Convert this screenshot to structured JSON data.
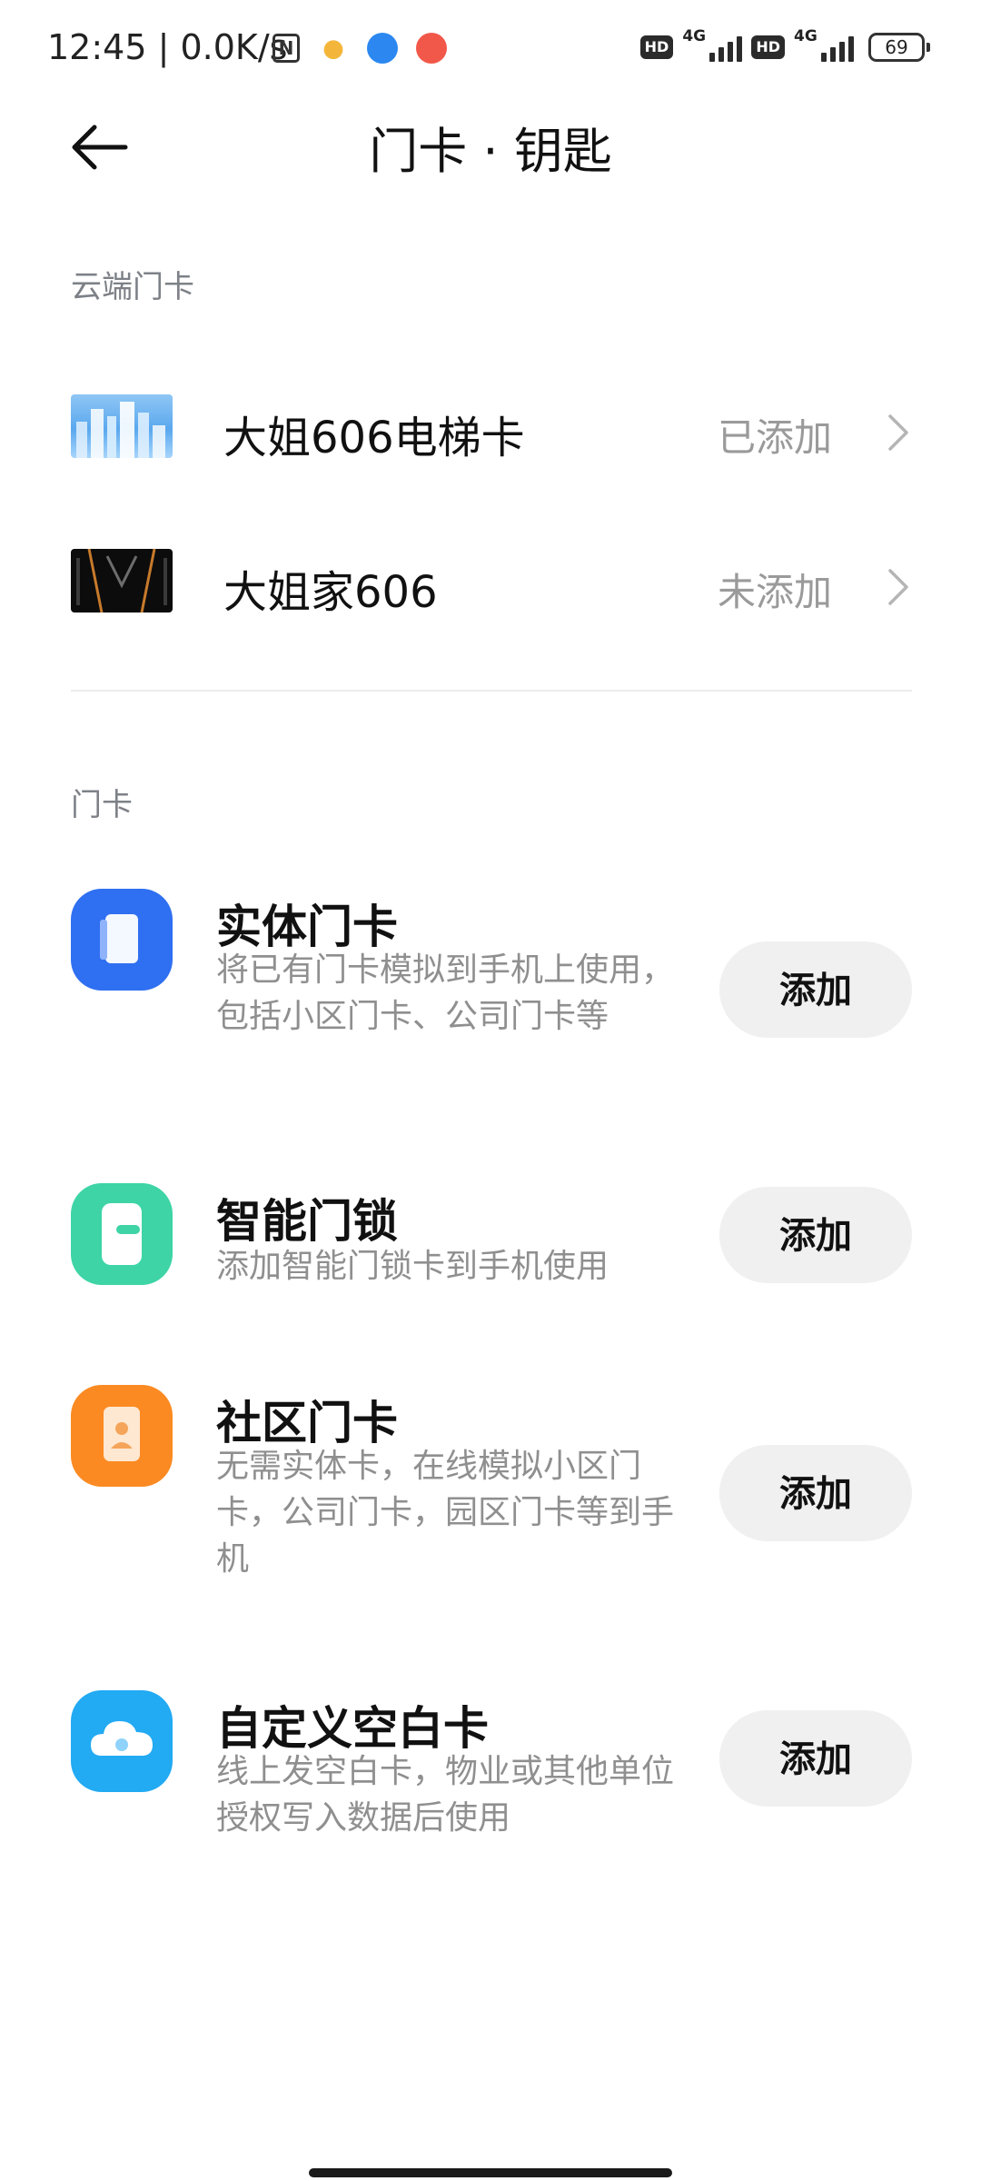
{
  "status_bar": {
    "time": "12:45 | 0.0K/s",
    "nfc": "N",
    "hd1": "HD",
    "net1": "4G",
    "hd2": "HD",
    "net2": "4G",
    "battery": "69"
  },
  "header": {
    "back_icon": "arrow-left-icon",
    "title": "门卡 · 钥匙"
  },
  "cloud_section": {
    "label": "云端门卡",
    "items": [
      {
        "name": "大姐606电梯卡",
        "status": "已添加",
        "thumbnail": "city-skyline"
      },
      {
        "name": "大姐家606",
        "status": "未添加",
        "thumbnail": "dark-pattern"
      }
    ]
  },
  "card_section": {
    "label": "门卡",
    "items": [
      {
        "title": "实体门卡",
        "desc": "将已有门卡模拟到手机上使用，包括小区门卡、公司门卡等",
        "button": "添加",
        "icon": "card-icon",
        "icon_color": "#2f6ff1"
      },
      {
        "title": "智能门锁",
        "desc": "添加智能门锁卡到手机使用",
        "button": "添加",
        "icon": "lock-icon",
        "icon_color": "#3ed4a6"
      },
      {
        "title": "社区门卡",
        "desc": "无需实体卡，在线模拟小区门卡，公司门卡，园区门卡等到手机",
        "button": "添加",
        "icon": "community-card-icon",
        "icon_color": "#fb8a22"
      },
      {
        "title": "自定义空白卡",
        "desc": "线上发空白卡，物业或其他单位授权写入数据后使用",
        "button": "添加",
        "icon": "cloud-icon",
        "icon_color": "#22aaf3"
      }
    ]
  }
}
